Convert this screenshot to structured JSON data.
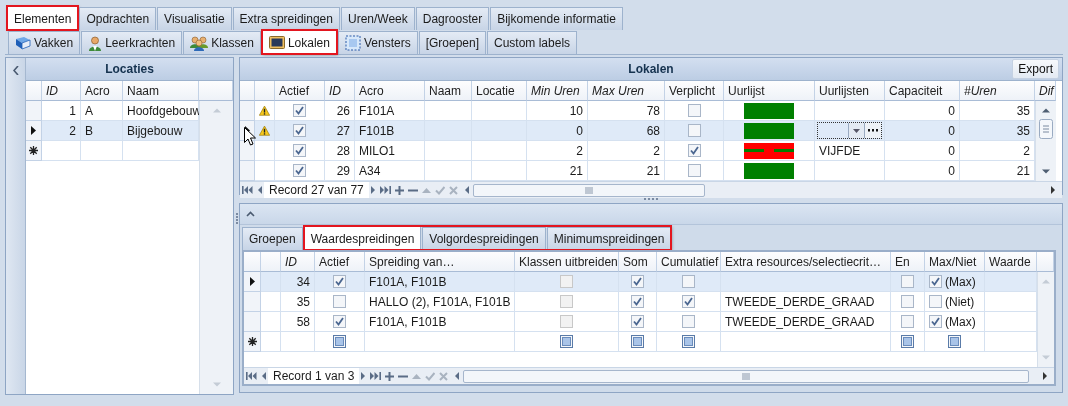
{
  "main_tabs": [
    {
      "label": "Elementen",
      "selected": true,
      "highlighted": true
    },
    {
      "label": "Opdrachten",
      "selected": false,
      "highlighted": false
    },
    {
      "label": "Visualisatie",
      "selected": false,
      "highlighted": false
    },
    {
      "label": "Extra spreidingen",
      "selected": false,
      "highlighted": false
    },
    {
      "label": "Uren/Week",
      "selected": false,
      "highlighted": false
    },
    {
      "label": "Dagrooster",
      "selected": false,
      "highlighted": false
    },
    {
      "label": "Bijkomende informatie",
      "selected": false,
      "highlighted": false
    }
  ],
  "element_tabs": [
    {
      "label": "Vakken",
      "kind": "book",
      "selected": false,
      "highlighted": false
    },
    {
      "label": "Leerkrachten",
      "kind": "person",
      "selected": false,
      "highlighted": false
    },
    {
      "label": "Klassen",
      "kind": "group",
      "selected": false,
      "highlighted": false
    },
    {
      "label": "Lokalen",
      "kind": "screen",
      "selected": true,
      "highlighted": true
    },
    {
      "label": "Vensters",
      "kind": "frame",
      "selected": false,
      "highlighted": false
    },
    {
      "label": "[Groepen]",
      "kind": "plain",
      "selected": false,
      "highlighted": false
    },
    {
      "label": "Custom labels",
      "kind": "plain",
      "selected": false,
      "highlighted": false
    }
  ],
  "locaties": {
    "title": "Locaties",
    "columns": [
      {
        "label": "ID",
        "kind": "number",
        "italic": true
      },
      {
        "label": "Acro",
        "kind": "text",
        "italic": false
      },
      {
        "label": "Naam",
        "kind": "text",
        "italic": false
      }
    ],
    "rows": [
      {
        "kind": "record",
        "selected": false,
        "cells": [
          "1",
          "A",
          "Hoofdgebouw"
        ]
      },
      {
        "kind": "record",
        "selected": true,
        "cells": [
          "2",
          "B",
          "Bijgebouw"
        ]
      },
      {
        "kind": "new",
        "selected": false,
        "cells": [
          null,
          null,
          null
        ]
      }
    ]
  },
  "lokalen": {
    "title": "Lokalen",
    "export_button": "Export",
    "columns": [
      {
        "kind": "warning"
      },
      {
        "label": "Actief",
        "kind": "check",
        "italic": false
      },
      {
        "label": "ID",
        "kind": "number",
        "italic": true
      },
      {
        "label": "Acro",
        "kind": "text",
        "italic": false
      },
      {
        "label": "Naam",
        "kind": "text",
        "italic": false
      },
      {
        "label": "Locatie",
        "kind": "text",
        "italic": false
      },
      {
        "label": "Min Uren",
        "kind": "number",
        "italic": true
      },
      {
        "label": "Max Uren",
        "kind": "number",
        "italic": true
      },
      {
        "label": "Verplicht",
        "kind": "check",
        "italic": false
      },
      {
        "label": "Uurlijst",
        "kind": "timetable",
        "italic": false
      },
      {
        "label": "Uurlijsten",
        "kind": "combo",
        "italic": false
      },
      {
        "label": "Capaciteit",
        "kind": "number",
        "italic": false
      },
      {
        "label": "#Uren",
        "kind": "number",
        "italic": true
      },
      {
        "label": "Dif",
        "italic": true
      }
    ],
    "rows": [
      {
        "selected": false,
        "cells": [
          true,
          true,
          "26",
          "F101A",
          null,
          null,
          "10",
          "78",
          false,
          {
            "color": "#008000"
          },
          null,
          "0",
          "35",
          null
        ]
      },
      {
        "selected": true,
        "cells": [
          true,
          true,
          "27",
          "F101B",
          null,
          null,
          "0",
          "68",
          false,
          {
            "color": "#008000"
          },
          {
            "editing": true
          },
          "0",
          "35",
          null
        ]
      },
      {
        "selected": false,
        "cells": [
          false,
          true,
          "28",
          "MILO1",
          null,
          null,
          "2",
          "2",
          true,
          {
            "color": "#ff0000",
            "stripe": {
              "color": "#008000"
            }
          },
          "VIJFDE",
          "0",
          "2",
          null
        ]
      },
      {
        "selected": false,
        "cells": [
          false,
          true,
          "29",
          "A34",
          null,
          null,
          "21",
          "21",
          false,
          {
            "color": "#008000"
          },
          null,
          "0",
          "21",
          null
        ]
      }
    ],
    "navigator": "Record 27 van 77"
  },
  "detail": {
    "tabs": [
      {
        "label": "Groepen",
        "selected": false,
        "highlighted": false
      },
      {
        "label": "Waardespreidingen",
        "selected": true,
        "highlighted": true
      },
      {
        "label": "Volgordespreidingen",
        "selected": false,
        "highlighted": true
      },
      {
        "label": "Minimumspreidingen",
        "selected": false,
        "highlighted": true
      }
    ],
    "columns": [
      {
        "kind": "blank"
      },
      {
        "label": "ID",
        "kind": "number",
        "italic": true
      },
      {
        "label": "Actief",
        "kind": "check",
        "italic": false
      },
      {
        "label": "Spreiding van…",
        "kind": "text",
        "italic": false
      },
      {
        "label": "Klassen uitbreiden",
        "kind": "check",
        "italic": false
      },
      {
        "label": "Som",
        "kind": "check",
        "italic": false
      },
      {
        "label": "Cumulatief",
        "kind": "check",
        "italic": false
      },
      {
        "label": "Extra resources/selectiecrit…",
        "kind": "text",
        "italic": false
      },
      {
        "label": "En",
        "kind": "check",
        "italic": false
      },
      {
        "label": "Max/Niet",
        "kind": "checklabel",
        "italic": false
      },
      {
        "label": "Waarde",
        "kind": "text",
        "italic": false
      }
    ],
    "rows": [
      {
        "kind": "record",
        "selected": true,
        "cells": [
          null,
          "34",
          true,
          "F101A, F101B",
          false,
          true,
          false,
          null,
          false,
          {
            "checked": true,
            "label": "(Max)"
          },
          null
        ]
      },
      {
        "kind": "record",
        "selected": false,
        "cells": [
          null,
          "35",
          false,
          "HALLO (2), F101A, F101B",
          false,
          true,
          true,
          "TWEEDE_DERDE_GRAAD",
          false,
          {
            "checked": false,
            "label": "(Niet)"
          },
          null
        ]
      },
      {
        "kind": "record",
        "selected": false,
        "cells": [
          null,
          "58",
          true,
          "F101A, F101B",
          false,
          true,
          false,
          "TWEEDE_DERDE_GRAAD",
          false,
          {
            "checked": true,
            "label": "(Max)"
          },
          null
        ]
      },
      {
        "kind": "new",
        "selected": false,
        "cells": [
          null,
          null,
          null,
          null,
          null,
          null,
          null,
          null,
          null,
          null,
          null
        ]
      }
    ],
    "navigator": "Record 1 van 3"
  }
}
